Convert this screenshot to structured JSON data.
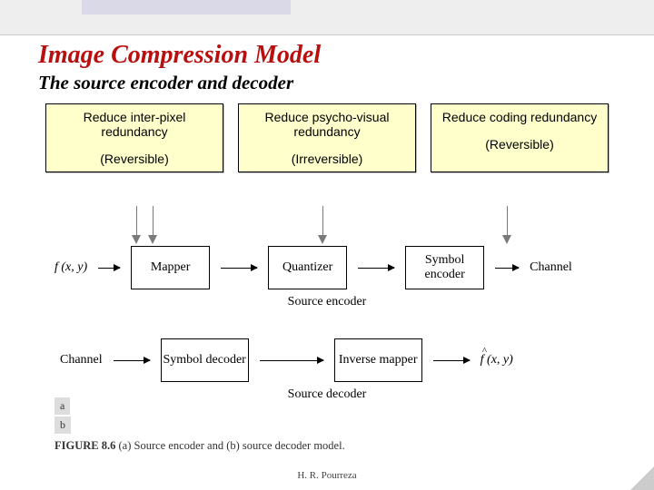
{
  "slide": {
    "title": "Image Compression Model",
    "subtitle": "The source encoder and decoder",
    "footer": "H. R. Pourreza"
  },
  "notes": [
    {
      "title": "Reduce inter-pixel redundancy",
      "sub": "(Reversible)"
    },
    {
      "title": "Reduce psycho-visual redundancy",
      "sub": "(Irreversible)"
    },
    {
      "title": "Reduce coding redundancy",
      "sub": "(Reversible)"
    }
  ],
  "encoder": {
    "input": "f (x, y)",
    "blocks": [
      "Mapper",
      "Quantizer",
      "Symbol encoder"
    ],
    "output": "Channel",
    "caption": "Source encoder"
  },
  "decoder": {
    "input": "Channel",
    "blocks": [
      "Symbol decoder",
      "Inverse mapper"
    ],
    "output": "f (x, y)",
    "caption": "Source decoder"
  },
  "figure": {
    "a": "a",
    "b": "b",
    "label": "FIGURE 8.6",
    "caption": "(a) Source encoder and (b) source decoder model."
  }
}
